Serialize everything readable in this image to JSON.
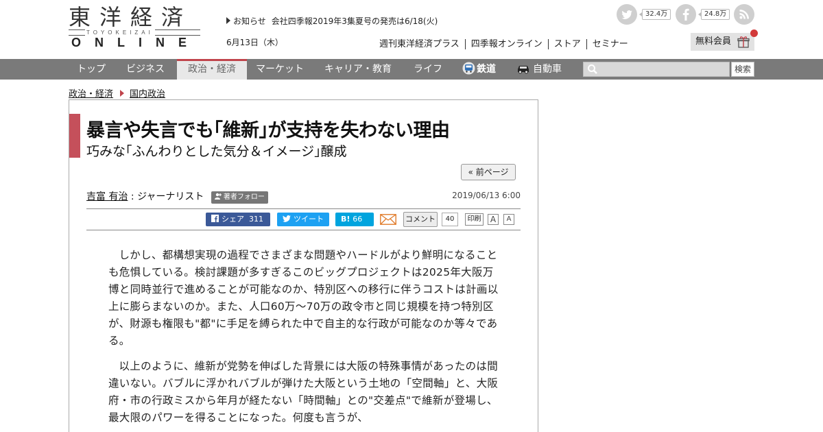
{
  "logo": {
    "kanji": "東洋経済",
    "roman": "TOYOKEIZAI",
    "online": "ONLINE"
  },
  "notice": {
    "label": "お知らせ",
    "text": "会社四季報2019年3集夏号の発売は6/18(火)"
  },
  "date": "6月13日（木）",
  "social": {
    "twitter_count": "32.4万",
    "facebook_count": "24.8万"
  },
  "topnav": [
    "週刊東洋経済プラス",
    "四季報オンライン",
    "ストア",
    "セミナー"
  ],
  "member_label": "無料会員",
  "mainnav": {
    "items": [
      "トップ",
      "ビジネス",
      "政治・経済",
      "マーケット",
      "キャリア・教育",
      "ライフ",
      "鉄道",
      "自動車"
    ],
    "active": "政治・経済"
  },
  "search": {
    "button": "検索",
    "placeholder": ""
  },
  "breadcrumb": [
    "政治・経済",
    "国内政治"
  ],
  "article": {
    "title": "暴言や失言でも｢維新｣が支持を失わない理由",
    "subtitle": "巧みな｢ふんわりとした気分＆イメージ｣醸成",
    "prev_page": "« 前ページ",
    "author": "吉富 有治",
    "author_role": ": ジャーナリスト",
    "follow_label": "著者フォロー",
    "published": "2019/06/13 6:00",
    "share": {
      "facebook": "シェア",
      "facebook_count": "311",
      "tweet": "ツイート",
      "hatena": "B!",
      "hatena_count": "66",
      "comment": "コメント",
      "comment_count": "40",
      "print": "印刷",
      "font_large": "A",
      "font_small": "A"
    },
    "paragraphs": [
      "しかし、都構想実現の過程でさまざまな問題やハードルがより鮮明になることも危惧している。検討課題が多すぎるこのビッグプロジェクトは2025年大阪万博と同時並行で進めることが可能なのか、特別区への移行に伴うコストは計画以上に膨らまないのか。また、人口60万～70万の政令市と同じ規模を持つ特別区が、財源も権限も\"都\"に手足を縛られた中で自主的な行政が可能なのか等々である。",
      "以上のように、維新が党勢を伸ばした背景には大阪の特殊事情があったのは間違いない。バブルに浮かれバブルが弾けた大阪という土地の「空間軸」と、大阪府・市の行政ミスから年月が経たない「時間軸」との\"交差点\"で維新が登場し、最大限のパワーを得ることになった。何度も言うが、"
    ]
  },
  "colors": {
    "accent": "#c5505b",
    "nav_bg": "#7a7a7a",
    "facebook": "#3b5998",
    "twitter": "#1da1f2",
    "hatena": "#00a4de"
  }
}
